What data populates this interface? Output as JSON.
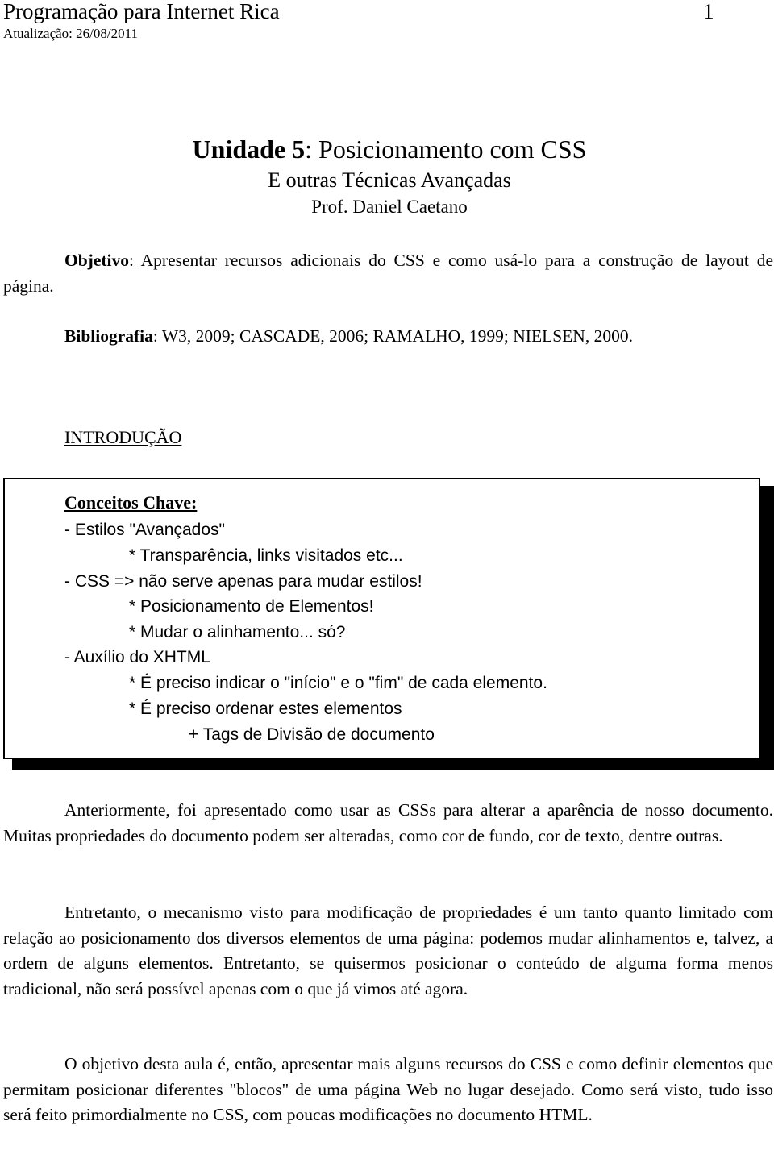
{
  "header": {
    "title": "Programação para Internet Rica",
    "page_number": "1",
    "updated": "Atualização: 26/08/2011"
  },
  "titles": {
    "unit_bold": "Unidade 5",
    "unit_rest": ": Posicionamento com CSS",
    "subtitle": "E outras Técnicas Avançadas",
    "author": "Prof. Daniel Caetano"
  },
  "objective": {
    "label": "Objetivo",
    "text": ": Apresentar recursos adicionais do CSS e como usá-lo para a construção de layout de página."
  },
  "bibliography": {
    "label": "Bibliografia",
    "text": ": W3, 2009; CASCADE, 2006; RAMALHO, 1999; NIELSEN, 2000."
  },
  "section_heading": "INTRODUÇÃO",
  "key_concepts": {
    "heading": "Conceitos Chave:",
    "lines": [
      "- Estilos \"Avançados\"",
      "* Transparência, links visitados etc...",
      "- CSS => não serve apenas para mudar estilos!",
      "* Posicionamento de Elementos!",
      "* Mudar o alinhamento... só?",
      "- Auxílio do XHTML",
      "* É preciso indicar o \"início\" e o \"fim\" de cada elemento.",
      "* É preciso ordenar estes elementos",
      "+ Tags de Divisão de documento"
    ]
  },
  "paragraphs": [
    "Anteriormente, foi apresentado como usar as CSSs para alterar a aparência de nosso documento. Muitas propriedades do documento podem ser alteradas, como cor de fundo, cor de texto, dentre outras.",
    "Entretanto, o mecanismo visto para modificação de propriedades é um tanto quanto limitado com relação ao posicionamento dos diversos elementos de uma página: podemos mudar alinhamentos e, talvez, a ordem de alguns elementos. Entretanto, se quisermos posicionar o conteúdo de alguma forma menos tradicional, não será possível apenas com o que já vimos até agora.",
    "O objetivo desta aula é, então, apresentar mais alguns recursos do CSS e como definir elementos que permitam posicionar diferentes \"blocos\" de uma página Web no lugar desejado. Como será visto, tudo isso será feito primordialmente no CSS, com poucas modificações no documento HTML."
  ]
}
